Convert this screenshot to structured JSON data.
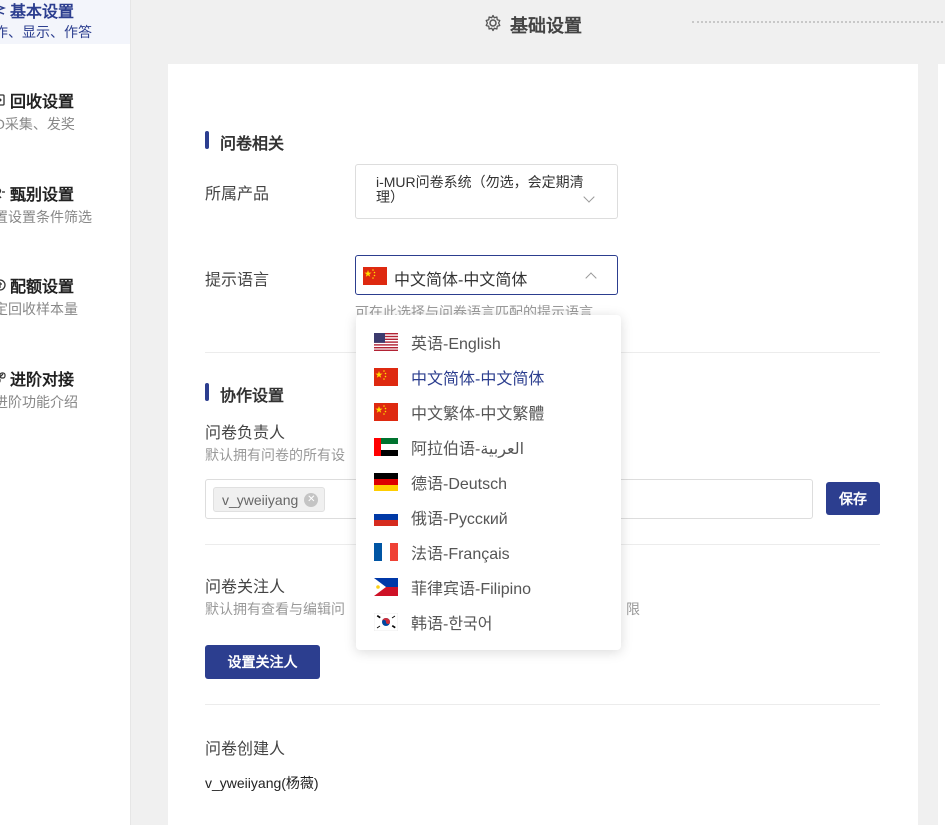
{
  "sidebar": {
    "items": [
      {
        "title": "基本设置",
        "subtitle": "作、显示、作答",
        "icon": "sliders-icon",
        "active": true
      },
      {
        "title": "回收设置",
        "subtitle": "O采集、发奖",
        "icon": "collect-icon",
        "active": false
      },
      {
        "title": "甄别设置",
        "subtitle": "置设置条件筛选",
        "icon": "filter-icon",
        "active": false
      },
      {
        "title": "配额设置",
        "subtitle": "定回收样本量",
        "icon": "quota-icon",
        "active": false
      },
      {
        "title": "进阶对接",
        "subtitle": "进阶功能介绍",
        "icon": "link-icon",
        "active": false
      }
    ]
  },
  "header": {
    "title": "基础设置",
    "icon": "gear-icon"
  },
  "survey_section": {
    "title": "问卷相关",
    "product_label": "所属产品",
    "product_value": "i-MUR问卷系统（勿选，会定期清理）",
    "language_label": "提示语言",
    "language_value": "中文简体-中文简体",
    "language_helper": "可在此选择与问卷语言匹配的提示语言"
  },
  "collab_section": {
    "title": "协作设置",
    "owner_label": "问卷负责人",
    "owner_helper": "默认拥有问卷的所有设",
    "owner_tag": "v_yweiiyang",
    "save_label": "保存",
    "watcher_label": "问卷关注人",
    "watcher_helper": "默认拥有查看与编辑问",
    "watcher_helper_tail": "限",
    "watcher_button": "设置关注人",
    "creator_label": "问卷创建人",
    "creator_value": "v_yweiiyang(杨薇)"
  },
  "language_dropdown": {
    "options": [
      {
        "label": "英语-English",
        "flag": "us-flag-icon",
        "selected": false
      },
      {
        "label": "中文简体-中文简体",
        "flag": "cn-flag-icon",
        "selected": true
      },
      {
        "label": "中文繁体-中文繁體",
        "flag": "cn-flag-icon",
        "selected": false
      },
      {
        "label": "阿拉伯语-العربية",
        "flag": "ae-flag-icon",
        "selected": false
      },
      {
        "label": "德语-Deutsch",
        "flag": "de-flag-icon",
        "selected": false
      },
      {
        "label": "俄语-Русский",
        "flag": "ru-flag-icon",
        "selected": false
      },
      {
        "label": "法语-Français",
        "flag": "fr-flag-icon",
        "selected": false
      },
      {
        "label": "菲律宾语-Filipino",
        "flag": "ph-flag-icon",
        "selected": false
      },
      {
        "label": "韩语-한국어",
        "flag": "kr-flag-icon",
        "selected": false
      }
    ]
  },
  "colors": {
    "accent": "#2c3e8f"
  }
}
